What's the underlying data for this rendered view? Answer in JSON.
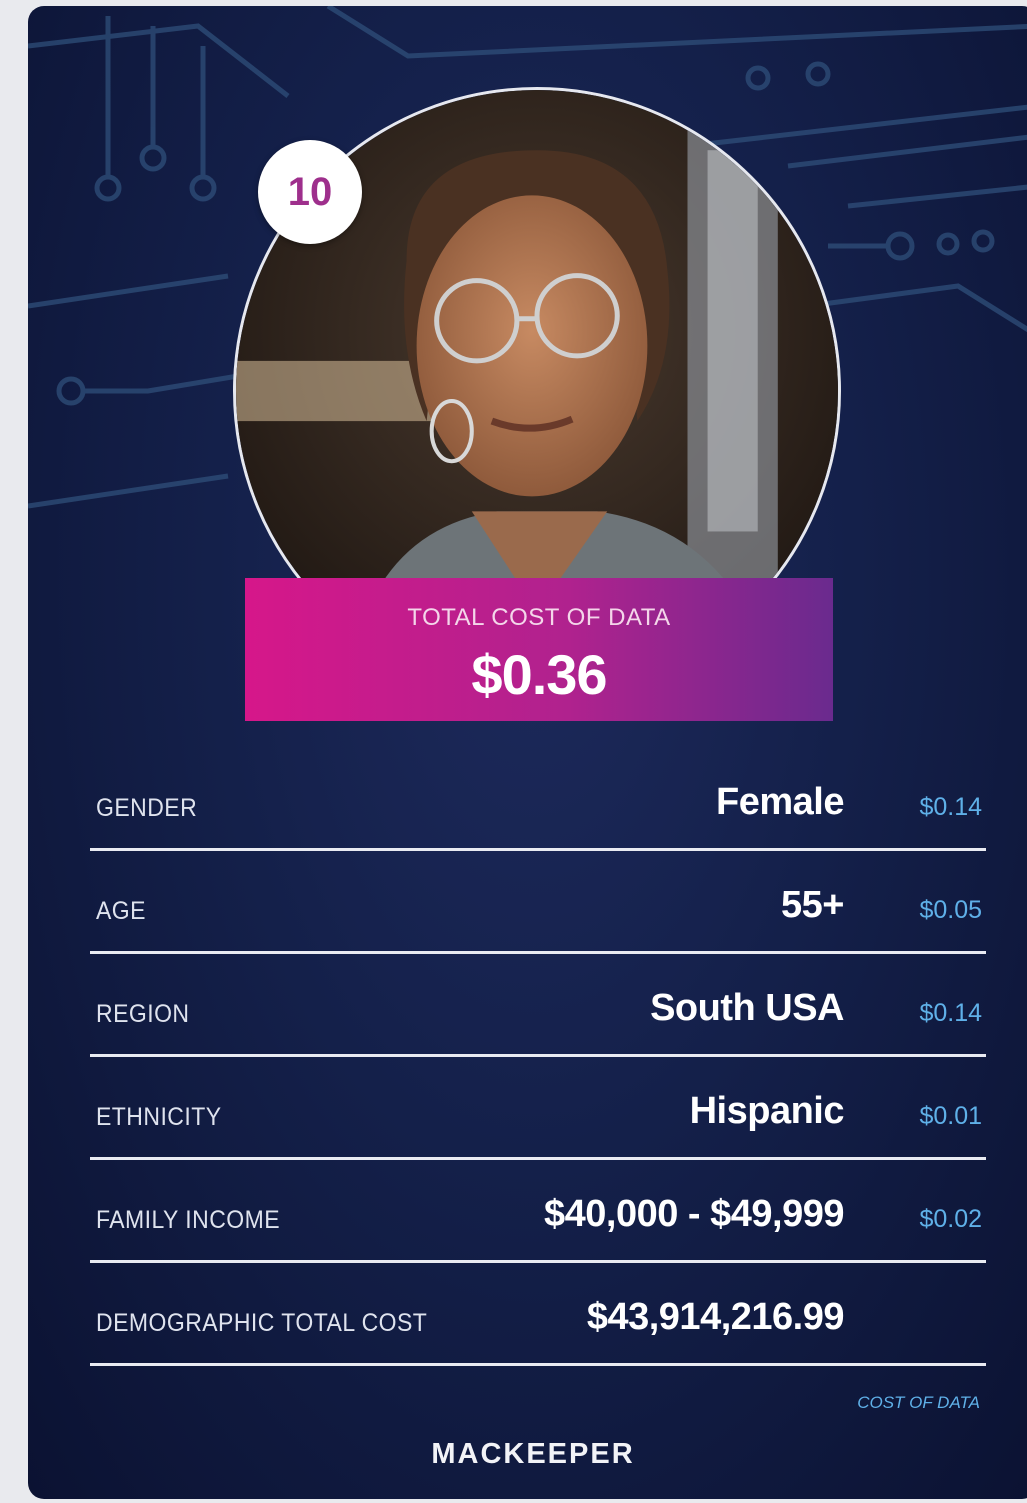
{
  "card": {
    "rank": "10",
    "portrait_icon": "woman-portrait-photo",
    "total_label": "TOTAL COST OF DATA",
    "total_value": "$0.36",
    "rows": [
      {
        "label": "GENDER",
        "value": "Female",
        "cost": "$0.14"
      },
      {
        "label": "AGE",
        "value": "55+",
        "cost": "$0.05"
      },
      {
        "label": "REGION",
        "value": "South USA",
        "cost": "$0.14"
      },
      {
        "label": "ETHNICITY",
        "value": "Hispanic",
        "cost": "$0.01"
      },
      {
        "label": "FAMILY INCOME",
        "value": "$40,000 - $49,999",
        "cost": "$0.02"
      },
      {
        "label": "DEMOGRAPHIC TOTAL COST",
        "value": "$43,914,216.99",
        "cost": ""
      }
    ],
    "cost_footnote": "COST OF DATA",
    "brand": "MACKEEPER"
  },
  "colors": {
    "background": "#14204a",
    "accent_pink": "#d6178a",
    "accent_purple": "#6a2a8e",
    "cost_blue": "#5fb0e8",
    "badge_text": "#9e2f8c"
  }
}
